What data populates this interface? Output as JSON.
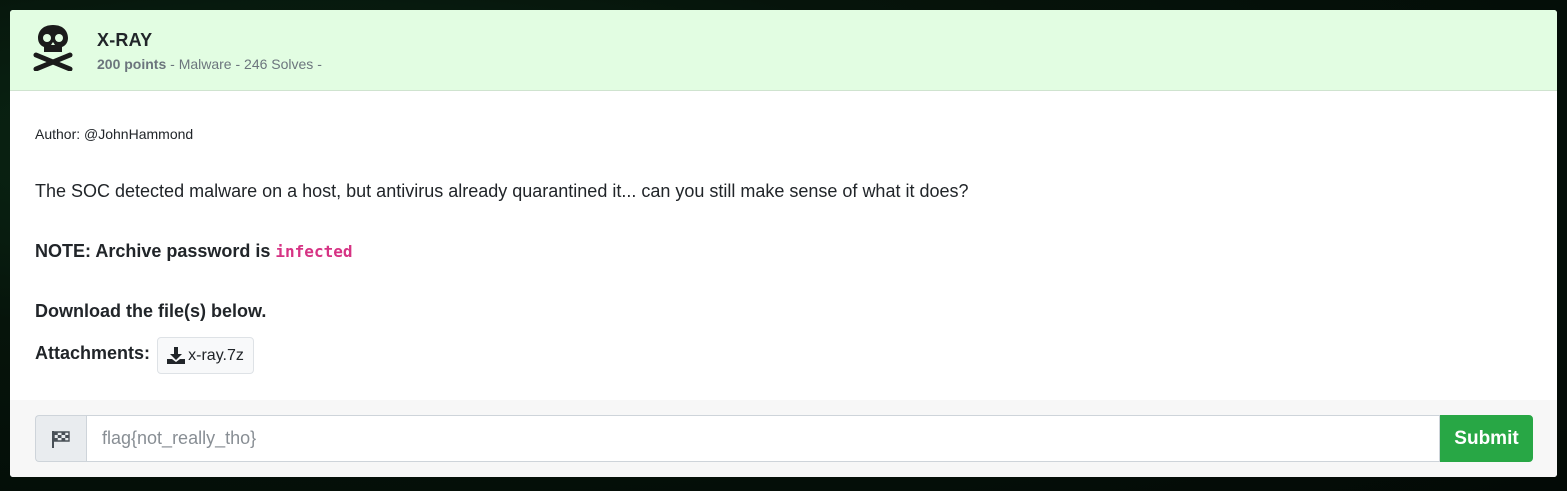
{
  "challenge": {
    "icon": "skull-crossbones-icon",
    "title": "X-RAY",
    "points": "200 points",
    "meta_rest": " - Malware - 246 Solves -",
    "header_color": "#e2fde2"
  },
  "body": {
    "author": "Author: @JohnHammond",
    "description": "The SOC detected malware on a host, but antivirus already quarantined it... can you still make sense of what it does?",
    "note_label": "NOTE: Archive password is ",
    "note_password": "infected",
    "download_text": "Download the file(s) below.",
    "attachments_label": "Attachments:",
    "attachment_icon": "download-icon",
    "attachment_name": "x-ray.7z"
  },
  "submission": {
    "addon_icon": "checkered-flag-icon",
    "placeholder": "flag{not_really_tho}",
    "value": "",
    "submit_label": "Submit",
    "submit_color": "#28a745"
  }
}
